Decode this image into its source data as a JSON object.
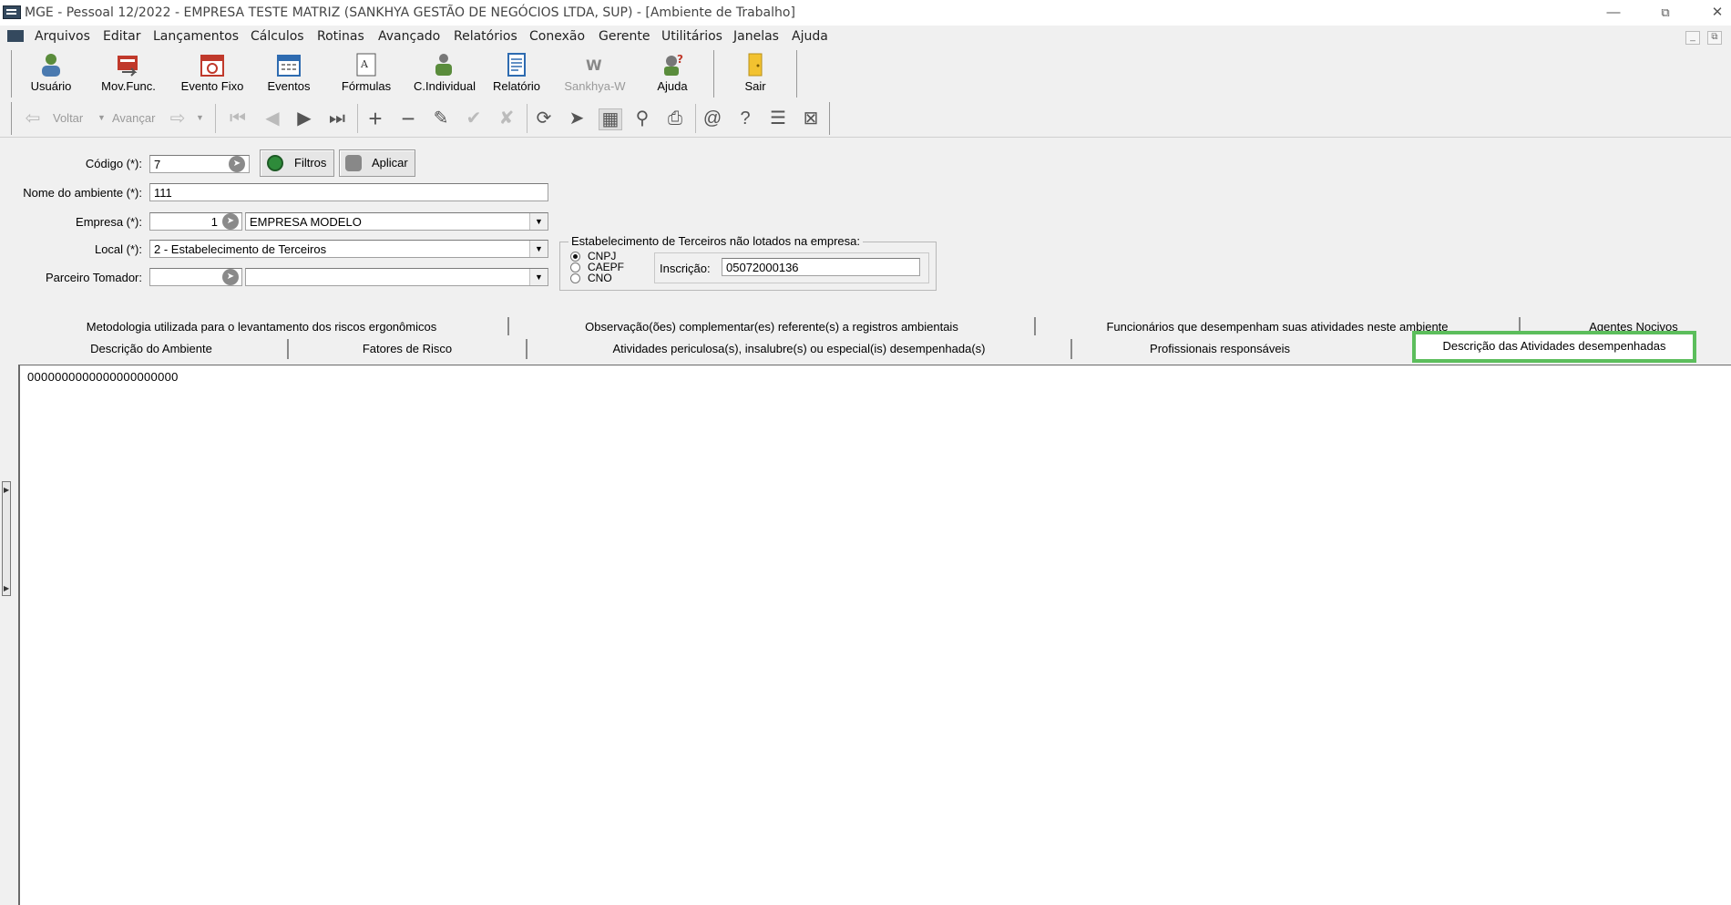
{
  "window": {
    "title": "MGE - Pessoal 12/2022 - EMPRESA TESTE MATRIZ (SANKHYA GESTÃO DE NEGÓCIOS LTDA, SUP) - [Ambiente de Trabalho]"
  },
  "menu": [
    "Arquivos",
    "Editar",
    "Lançamentos",
    "Cálculos",
    "Rotinas",
    "Avançado",
    "Relatórios",
    "Conexão",
    "Gerente",
    "Utilitários",
    "Janelas",
    "Ajuda"
  ],
  "toolbar1": [
    "Usuário",
    "Mov.Func.",
    "Evento Fixo",
    "Eventos",
    "Fórmulas",
    "C.Individual",
    "Relatório",
    "Sankhya-W",
    "Ajuda",
    "Sair"
  ],
  "toolbar2": {
    "back": "Voltar",
    "forward": "Avançar"
  },
  "form": {
    "codigo_label": "Código (*):",
    "codigo_value": "7",
    "filtros_label": "Filtros",
    "aplicar_label": "Aplicar",
    "nome_label": "Nome do ambiente (*):",
    "nome_value": "111",
    "empresa_label": "Empresa (*):",
    "empresa_code": "1",
    "empresa_name": "EMPRESA MODELO",
    "local_label": "Local (*):",
    "local_value": "2 - Estabelecimento de Terceiros",
    "parceiro_label": "Parceiro Tomador:",
    "parceiro_code": "",
    "parceiro_name": ""
  },
  "terceiros": {
    "caption": "Estabelecimento de Terceiros não lotados na empresa:",
    "options": [
      "CNPJ",
      "CAEPF",
      "CNO"
    ],
    "selected": "CNPJ",
    "inscricao_label": "Inscrição:",
    "inscricao_value": "05072000136"
  },
  "tabs": {
    "row1": [
      "Metodologia utilizada para o levantamento dos riscos ergonômicos",
      "Observação(ões) complementar(es) referente(s) a registros ambientais",
      "Funcionários que desempenham suas atividades neste ambiente",
      "Agentes Nocivos"
    ],
    "row2": [
      "Descrição do Ambiente",
      "Fatores de Risco",
      "Atividades periculosa(s), insalubre(s) ou especial(is) desempenhada(s)",
      "Profissionais responsáveis",
      "Descrição das Atividades desempenhadas"
    ]
  },
  "content": {
    "text": "0000000000000000000000"
  },
  "colors": {
    "highlight": "#5cbe5c",
    "background": "#f0f0f0"
  }
}
